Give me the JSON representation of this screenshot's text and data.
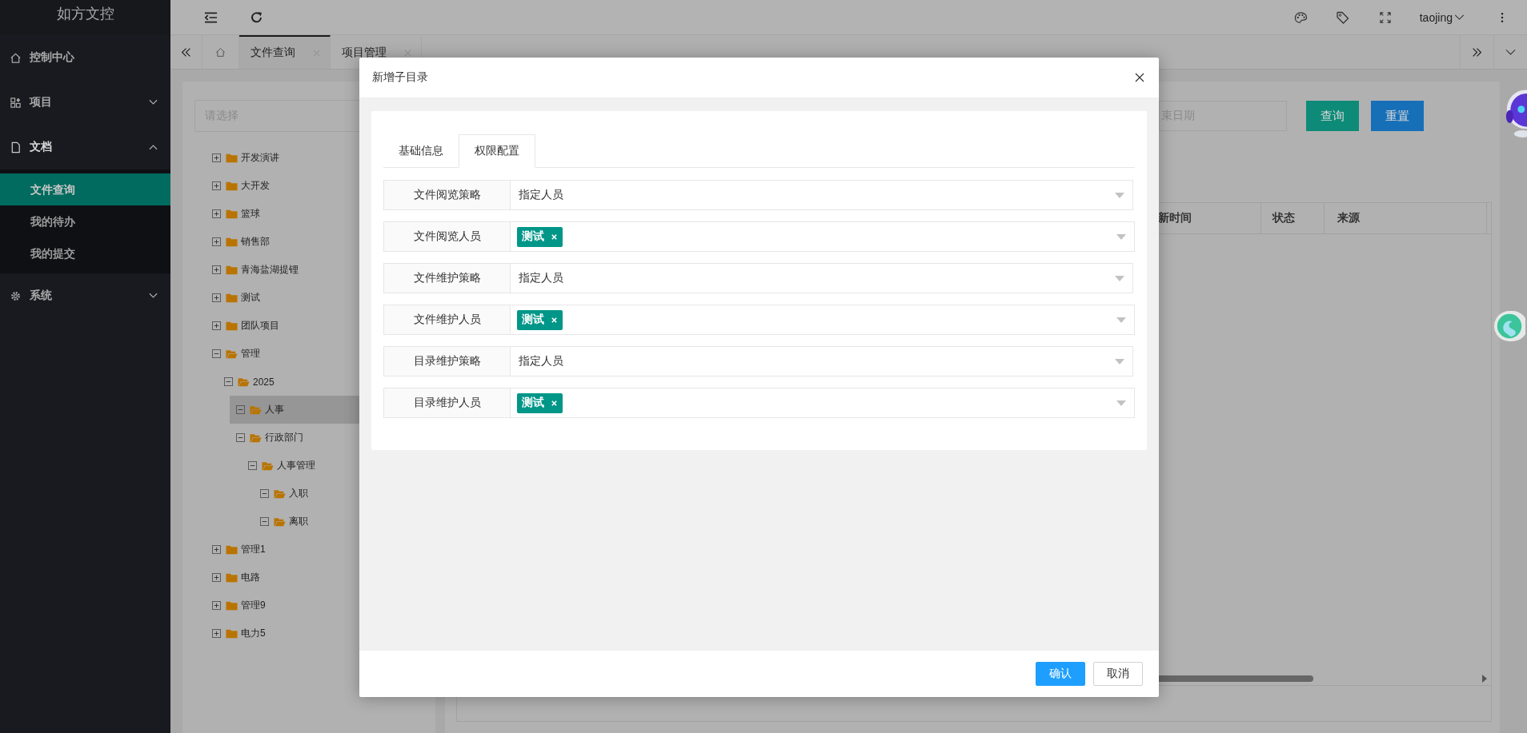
{
  "app": {
    "title": "如方文控"
  },
  "sidebar": {
    "items": [
      {
        "label": "控制中心",
        "kind": "link"
      },
      {
        "label": "项目",
        "kind": "group",
        "expanded": false
      },
      {
        "label": "文档",
        "kind": "group",
        "expanded": true,
        "children": [
          {
            "label": "文件查询",
            "selected": true
          },
          {
            "label": "我的待办",
            "selected": false
          },
          {
            "label": "我的提交",
            "selected": false
          }
        ]
      },
      {
        "label": "系统",
        "kind": "group",
        "expanded": false
      }
    ]
  },
  "header": {
    "user": "taojing"
  },
  "tabs": [
    {
      "label": "文件查询",
      "selected": true
    },
    {
      "label": "项目管理",
      "selected": false
    }
  ],
  "tree": {
    "placeholder": "请选择",
    "nodes": [
      {
        "label": "开发演讲",
        "expanded": false,
        "selected": false
      },
      {
        "label": "大开发",
        "expanded": false,
        "selected": false
      },
      {
        "label": "篮球",
        "expanded": false,
        "selected": false
      },
      {
        "label": "销售部",
        "expanded": false,
        "selected": false
      },
      {
        "label": "青海盐湖提锂",
        "expanded": false,
        "selected": false
      },
      {
        "label": "测试",
        "expanded": false,
        "selected": false
      },
      {
        "label": "团队项目",
        "expanded": false,
        "selected": false
      },
      {
        "label": "管理",
        "expanded": true,
        "selected": false,
        "children": [
          {
            "label": "2025",
            "expanded": true,
            "selected": false,
            "children": [
              {
                "label": "人事",
                "expanded": true,
                "selected": true
              },
              {
                "label": "行政部门",
                "expanded": true,
                "selected": false,
                "children": [
                  {
                    "label": "人事管理",
                    "expanded": true,
                    "selected": false,
                    "children": [
                      {
                        "label": "入职",
                        "expanded": true,
                        "selected": false
                      },
                      {
                        "label": "离职",
                        "expanded": true,
                        "selected": false
                      }
                    ]
                  }
                ]
              }
            ]
          }
        ]
      },
      {
        "label": "管理1",
        "expanded": false,
        "selected": false
      },
      {
        "label": "电路",
        "expanded": false,
        "selected": false
      },
      {
        "label": "管理9",
        "expanded": false,
        "selected": false
      },
      {
        "label": "电力5",
        "expanded": false,
        "selected": false
      }
    ]
  },
  "search": {
    "end_date_placeholder": "束日期",
    "buttons": [
      {
        "label": "查询",
        "kind": "search"
      },
      {
        "label": "重置",
        "kind": "reset"
      }
    ]
  },
  "table": {
    "columns": [
      "新时间",
      "状态",
      "来源"
    ]
  },
  "dialog": {
    "title": "新增子目录",
    "tabs": [
      {
        "label": "基础信息",
        "selected": false
      },
      {
        "label": "权限配置",
        "selected": true
      }
    ],
    "fields": [
      {
        "label": "文件阅览策略",
        "kind": "select",
        "value": "指定人员"
      },
      {
        "label": "文件阅览人员",
        "kind": "tags",
        "tags": [
          "测试"
        ]
      },
      {
        "label": "文件维护策略",
        "kind": "select",
        "value": "指定人员"
      },
      {
        "label": "文件维护人员",
        "kind": "tags",
        "tags": [
          "测试"
        ]
      },
      {
        "label": "目录维护策略",
        "kind": "select",
        "value": "指定人员"
      },
      {
        "label": "目录维护人员",
        "kind": "tags",
        "tags": [
          "测试"
        ]
      }
    ],
    "buttons": [
      {
        "label": "确认",
        "kind": "primary"
      },
      {
        "label": "取消",
        "kind": "default"
      }
    ]
  }
}
